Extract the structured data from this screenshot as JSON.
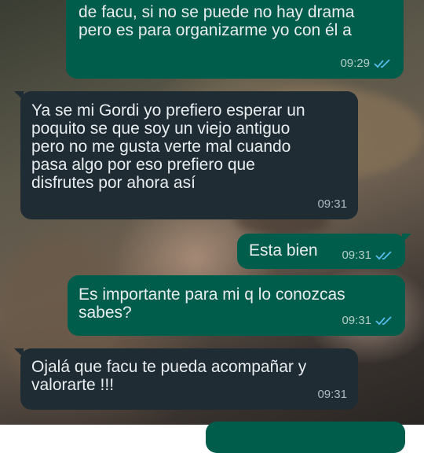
{
  "colors": {
    "incoming_bubble": "#1f2c34",
    "outgoing_bubble": "#005c4b",
    "read_ticks": "#53bdeb",
    "text": "#e9edef"
  },
  "messages": [
    {
      "direction": "outgoing",
      "text": "de facu, si no se puede no hay drama\npero es para organizarme yo con él a",
      "time": "09:29",
      "status": "read"
    },
    {
      "direction": "incoming",
      "text": "Ya se mi Gordi yo prefiero esperar un\npoquito se que soy un viejo antiguo\npero no me gusta verte mal cuando\npasa algo por eso prefiero que\ndisfrutes por ahora así",
      "time": "09:31"
    },
    {
      "direction": "outgoing",
      "text": "Esta bien",
      "time": "09:31",
      "status": "read"
    },
    {
      "direction": "outgoing",
      "text": "Es importante para mi q lo conozcas\nsabes?",
      "time": "09:31",
      "status": "read"
    },
    {
      "direction": "incoming",
      "text": "Ojalá que facu te pueda acompañar y\nvalorarte  !!!",
      "time": "09:31"
    }
  ]
}
